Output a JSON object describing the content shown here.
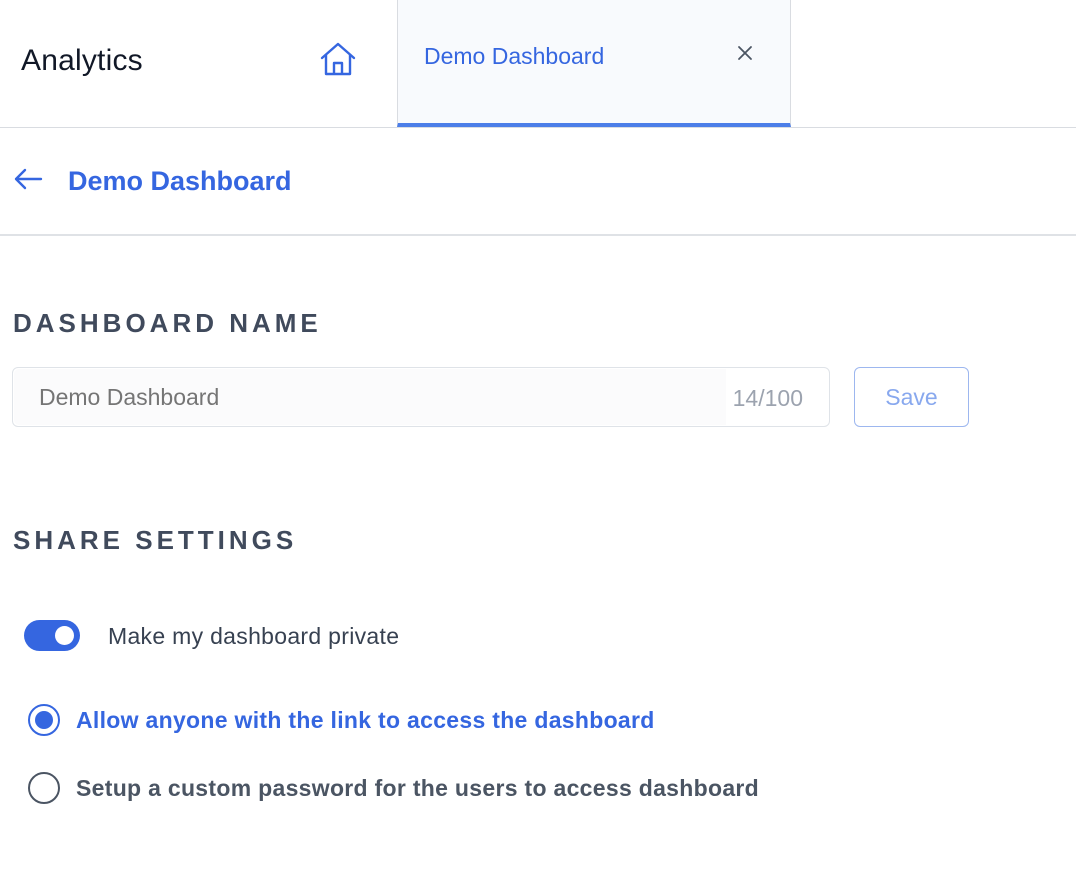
{
  "header": {
    "app_title": "Analytics",
    "home_icon": "home-icon",
    "tab": {
      "label": "Demo Dashboard",
      "close_icon": "close-icon"
    }
  },
  "subheader": {
    "back_icon": "arrow-left-icon",
    "title": "Demo Dashboard"
  },
  "dashboard_name": {
    "heading": "DASHBOARD NAME",
    "input_placeholder": "Demo Dashboard",
    "char_count": "14/100",
    "save_label": "Save"
  },
  "share_settings": {
    "heading": "SHARE SETTINGS",
    "private_toggle": {
      "label": "Make my dashboard private",
      "on": true
    },
    "options": [
      {
        "label": "Allow anyone with the link to access the dashboard",
        "selected": true
      },
      {
        "label": "Setup a custom password for the users to access dashboard",
        "selected": false
      }
    ]
  },
  "colors": {
    "accent": "#3566e0",
    "tab_underline": "#4c7ee8",
    "heading_text": "#404a5c"
  }
}
